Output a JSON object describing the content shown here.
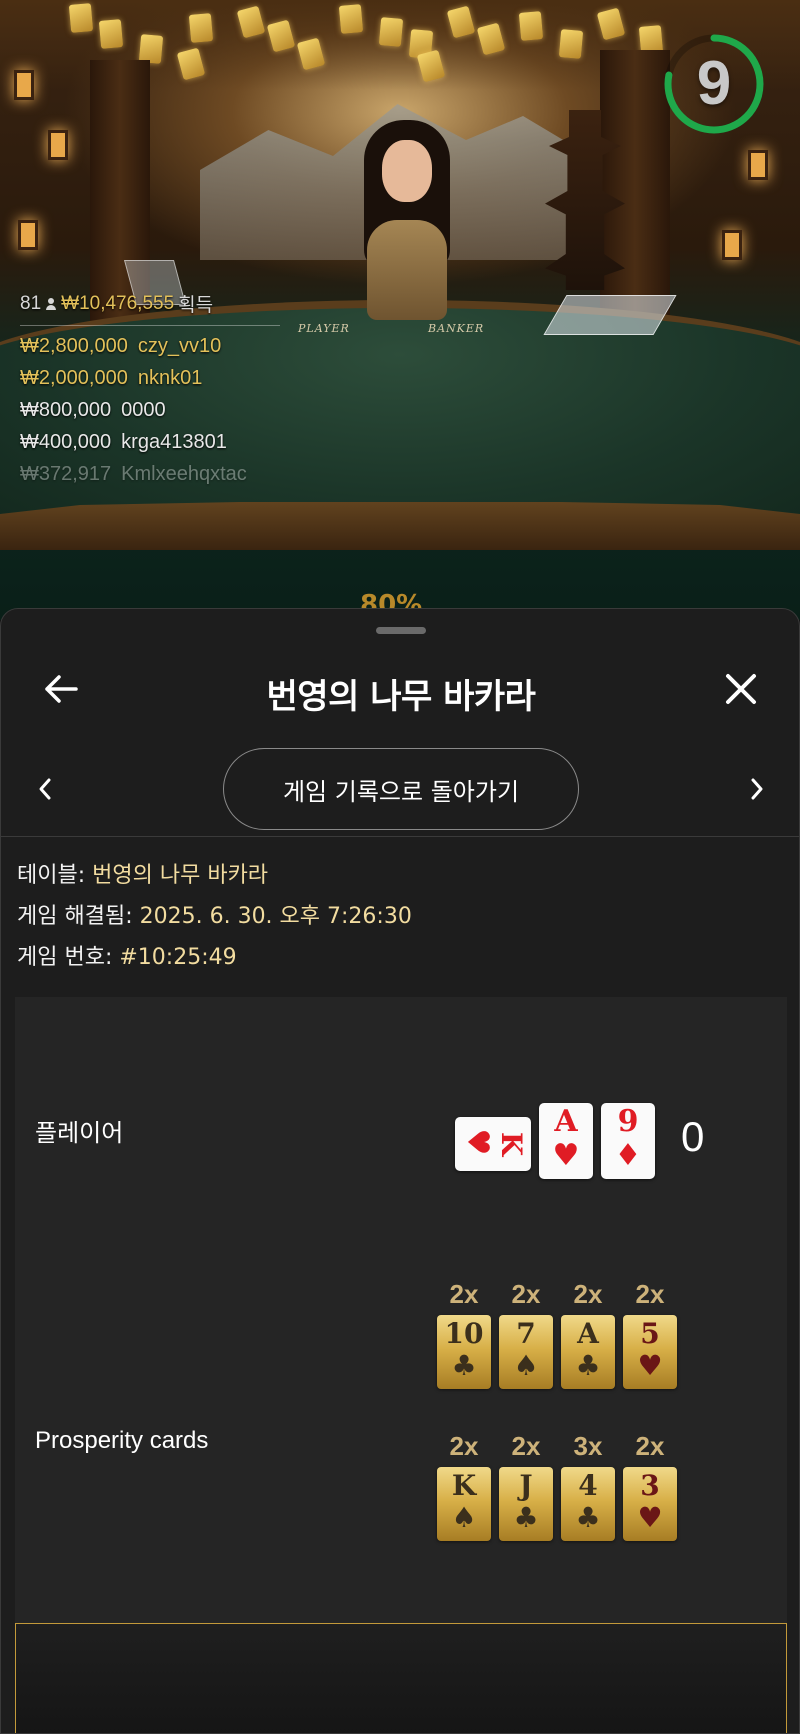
{
  "scene": {
    "timer": "9",
    "timer_progress": 0.78,
    "table_labels": [
      "PLAYER",
      "BANKER"
    ],
    "winners": {
      "count": "81",
      "total": "₩10,476,555",
      "total_suffix": "획득",
      "rows": [
        {
          "amount": "₩2,800,000",
          "user": "czy_vv10",
          "style": "gold"
        },
        {
          "amount": "₩2,000,000",
          "user": "nknk01",
          "style": "gold"
        },
        {
          "amount": "₩800,000",
          "user": "0000",
          "style": "white"
        },
        {
          "amount": "₩400,000",
          "user": "krga413801",
          "style": "white"
        },
        {
          "amount": "₩372,917",
          "user": "Kmlxeehqxtac",
          "style": "fade"
        }
      ]
    },
    "percent_peek": "80%"
  },
  "sheet": {
    "title": "번영의 나무 바카라",
    "back_history_label": "게임 기록으로 돌아가기",
    "info": {
      "table_label": "테이블: ",
      "table_value": "번영의 나무 바카라",
      "resolved_label": "게임 해결됨: ",
      "resolved_value": "2025. 6. 30. 오후 7:26:30",
      "number_label": "게임 번호: ",
      "number_value": "#10:25:49"
    },
    "player": {
      "label": "플레이어",
      "score": "0",
      "cards": [
        {
          "rank": "K",
          "suit": "♥",
          "orientation": "side"
        },
        {
          "rank": "A",
          "suit": "♥",
          "orientation": "up"
        },
        {
          "rank": "9",
          "suit": "♦",
          "orientation": "up"
        }
      ]
    },
    "prosperity": {
      "label": "Prosperity cards",
      "row1": [
        {
          "mult": "2x",
          "rank": "10",
          "suit": "♣",
          "red": false
        },
        {
          "mult": "2x",
          "rank": "7",
          "suit": "♠",
          "red": false
        },
        {
          "mult": "2x",
          "rank": "A",
          "suit": "♣",
          "red": false
        },
        {
          "mult": "2x",
          "rank": "5",
          "suit": "♥",
          "red": true
        }
      ],
      "row2": [
        {
          "mult": "2x",
          "rank": "K",
          "suit": "♠",
          "red": false
        },
        {
          "mult": "2x",
          "rank": "J",
          "suit": "♣",
          "red": false
        },
        {
          "mult": "3x",
          "rank": "4",
          "suit": "♣",
          "red": false
        },
        {
          "mult": "2x",
          "rank": "3",
          "suit": "♥",
          "red": true
        }
      ]
    }
  },
  "colors": {
    "gold": "#e3c15a",
    "timer_ring": "#1fa84a",
    "info_value": "#f2dca0",
    "card_red": "#e01c24"
  }
}
